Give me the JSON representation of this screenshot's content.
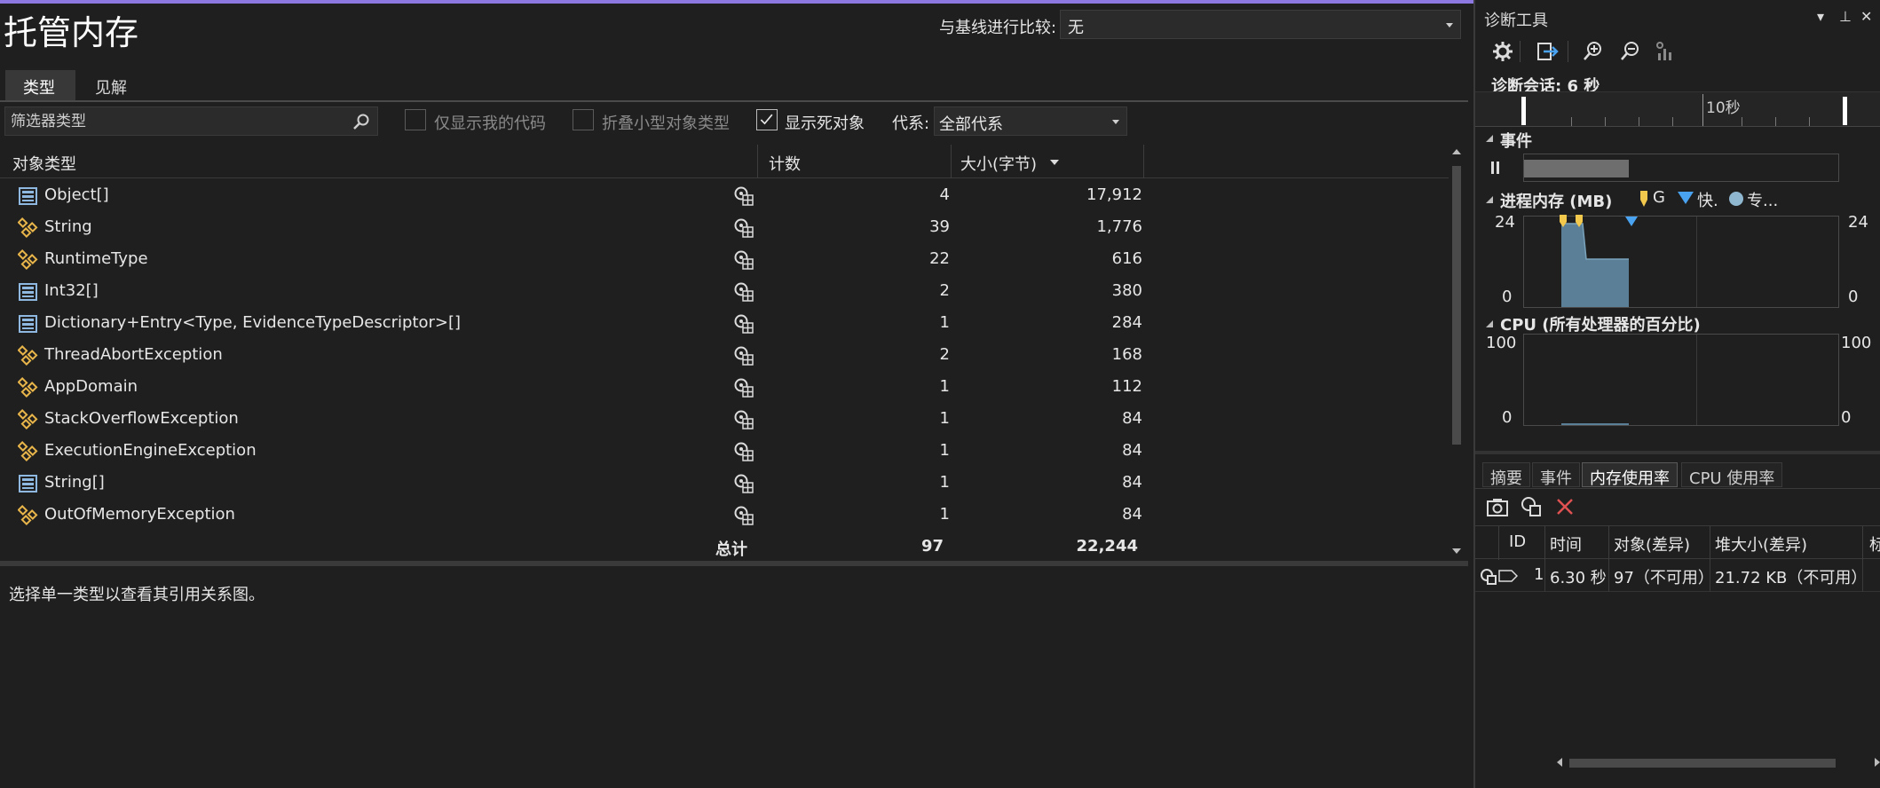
{
  "left": {
    "title": "托管内存",
    "compare": {
      "label": "与基线进行比较:",
      "value": "无"
    },
    "tabs": [
      {
        "label": "类型"
      },
      {
        "label": "见解"
      }
    ],
    "filter": {
      "placeholder": "筛选器类型"
    },
    "checkboxes": [
      {
        "label": "仅显示我的代码",
        "checked": false
      },
      {
        "label": "折叠小型对象类型",
        "checked": false
      },
      {
        "label": "显示死对象",
        "checked": true
      }
    ],
    "generation": {
      "label": "代系:",
      "value": "全部代系"
    },
    "columns": {
      "type": "对象类型",
      "count": "计数",
      "size": "大小(字节)"
    },
    "rows": [
      {
        "icon": "array-icon",
        "name": "Object[]",
        "count": "4",
        "size": "17,912"
      },
      {
        "icon": "class-icon",
        "name": "String",
        "count": "39",
        "size": "1,776"
      },
      {
        "icon": "class-icon",
        "name": "RuntimeType",
        "count": "22",
        "size": "616"
      },
      {
        "icon": "array-icon",
        "name": "Int32[]",
        "count": "2",
        "size": "380"
      },
      {
        "icon": "array-icon",
        "name": "Dictionary+Entry<Type, EvidenceTypeDescriptor>[]",
        "count": "1",
        "size": "284"
      },
      {
        "icon": "class-icon",
        "name": "ThreadAbortException",
        "count": "2",
        "size": "168"
      },
      {
        "icon": "class-icon",
        "name": "AppDomain",
        "count": "1",
        "size": "112"
      },
      {
        "icon": "class-icon",
        "name": "StackOverflowException",
        "count": "1",
        "size": "84"
      },
      {
        "icon": "class-icon",
        "name": "ExecutionEngineException",
        "count": "1",
        "size": "84"
      },
      {
        "icon": "array-icon",
        "name": "String[]",
        "count": "1",
        "size": "84"
      },
      {
        "icon": "class-icon",
        "name": "OutOfMemoryException",
        "count": "1",
        "size": "84"
      }
    ],
    "total": {
      "label": "总计",
      "count": "97",
      "size": "22,244"
    },
    "hint": "选择单一类型以查看其引用关系图。"
  },
  "right": {
    "title": "诊断工具",
    "session": "诊断会话: 6 秒",
    "ruler_label": "10秒",
    "events_label": "事件",
    "memory": {
      "label": "进程内存 (MB)",
      "legend": [
        {
          "name": "G",
          "color": "#f2c94c"
        },
        {
          "name": "快.",
          "color": "#4aa3f0"
        },
        {
          "name": "专...",
          "color": "#8fb8d0"
        }
      ],
      "y_top": "24",
      "y_bottom": "0"
    },
    "cpu": {
      "label": "CPU (所有处理器的百分比)",
      "y_top": "100",
      "y_bottom": "0"
    },
    "tabs": [
      "摘要",
      "事件",
      "内存使用率",
      "CPU 使用率"
    ],
    "grid": {
      "headers": [
        "ID",
        "时间",
        "对象(差异)",
        "堆大小(差异)",
        "标"
      ],
      "row": {
        "id": "1",
        "time": "6.30 秒",
        "objects": "97（不可用）",
        "heap": "21.72 KB（不可用）"
      }
    },
    "colors": {
      "accent": "#8c78e0",
      "memory_fill": "#5a7f96",
      "close_red": "#e05252"
    }
  }
}
